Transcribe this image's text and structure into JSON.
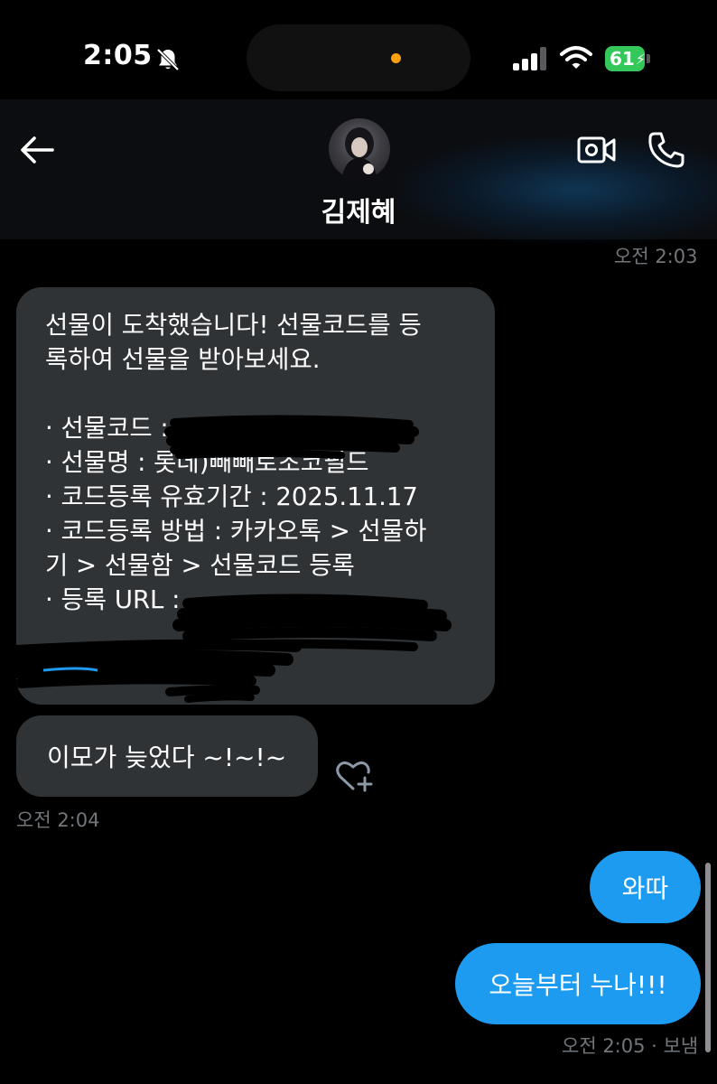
{
  "status_bar": {
    "time": "2:05",
    "battery": "61"
  },
  "header": {
    "contact_name": "김제혜"
  },
  "messages": {
    "timestamp_top": "오전 2:03",
    "gift_lines": [
      "선물이 도착했습니다! 선물코드를 등",
      "록하여 선물을 받아보세요.",
      "",
      "· 선물코드 :",
      "· 선물명 : 롯데)빼빼로초코필드",
      "· 코드등록 유효기간 : 2025.11.17",
      "· 코드등록 방법 : 카카오톡 > 선물하",
      "기 > 선물함 > 선물코드 등록",
      "· 등록 URL :"
    ],
    "received_2": "이모가 늦었다 ~!~!~",
    "timestamp_received": "오전 2:04",
    "sent_1": "와따",
    "sent_2": "오늘부터 누나!!!",
    "timestamp_sent": "오전 2:05 · 보냄"
  },
  "colors": {
    "background": "#000000",
    "received_bubble": "#2f3336",
    "sent_bubble": "#1d9bf0",
    "timestamp": "#71767b",
    "battery": "#34c759"
  },
  "icons": [
    "bell-slash-icon",
    "signal-icon",
    "wifi-icon",
    "back-arrow-icon",
    "video-call-icon",
    "phone-icon",
    "heart-plus-icon"
  ]
}
